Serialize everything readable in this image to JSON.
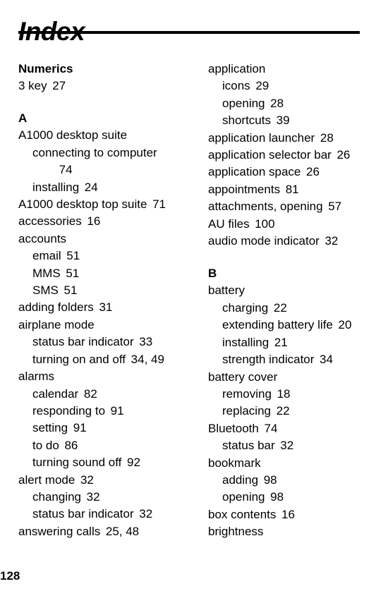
{
  "page": {
    "title": "Index",
    "folio": "128"
  },
  "columns": {
    "left": [
      {
        "kind": "section",
        "label": "Numerics",
        "spaced": false
      },
      {
        "kind": "entry",
        "level": 0,
        "term": "3 key",
        "locator": "27"
      },
      {
        "kind": "section",
        "label": "A",
        "spaced": true
      },
      {
        "kind": "entry",
        "level": 0,
        "term": "A1000 desktop suite",
        "locator": ""
      },
      {
        "kind": "entry",
        "level": 1,
        "term": "connecting to computer",
        "locator": ""
      },
      {
        "kind": "entry",
        "level": 2,
        "term": "",
        "locator": "74"
      },
      {
        "kind": "entry",
        "level": 1,
        "term": "installing",
        "locator": "24"
      },
      {
        "kind": "entry",
        "level": 0,
        "term": "A1000 desktop top suite",
        "locator": "71"
      },
      {
        "kind": "entry",
        "level": 0,
        "term": "accessories",
        "locator": "16"
      },
      {
        "kind": "entry",
        "level": 0,
        "term": "accounts",
        "locator": ""
      },
      {
        "kind": "entry",
        "level": 1,
        "term": "email",
        "locator": "51"
      },
      {
        "kind": "entry",
        "level": 1,
        "term": "MMS",
        "locator": "51"
      },
      {
        "kind": "entry",
        "level": 1,
        "term": "SMS",
        "locator": "51"
      },
      {
        "kind": "entry",
        "level": 0,
        "term": "adding folders",
        "locator": "31"
      },
      {
        "kind": "entry",
        "level": 0,
        "term": "airplane mode",
        "locator": ""
      },
      {
        "kind": "entry",
        "level": 1,
        "term": "status bar indicator",
        "locator": "33"
      },
      {
        "kind": "entry",
        "level": 1,
        "term": "turning on and off",
        "locator": "34, 49"
      },
      {
        "kind": "entry",
        "level": 0,
        "term": "alarms",
        "locator": ""
      },
      {
        "kind": "entry",
        "level": 1,
        "term": "calendar",
        "locator": "82"
      },
      {
        "kind": "entry",
        "level": 1,
        "term": "responding to",
        "locator": "91"
      },
      {
        "kind": "entry",
        "level": 1,
        "term": "setting",
        "locator": "91"
      },
      {
        "kind": "entry",
        "level": 1,
        "term": "to do",
        "locator": "86"
      },
      {
        "kind": "entry",
        "level": 1,
        "term": "turning sound off",
        "locator": "92"
      },
      {
        "kind": "entry",
        "level": 0,
        "term": "alert mode",
        "locator": "32"
      },
      {
        "kind": "entry",
        "level": 1,
        "term": "changing",
        "locator": "32"
      },
      {
        "kind": "entry",
        "level": 1,
        "term": "status bar indicator",
        "locator": "32"
      },
      {
        "kind": "entry",
        "level": 0,
        "term": "answering calls",
        "locator": "25, 48"
      }
    ],
    "right": [
      {
        "kind": "entry",
        "level": 0,
        "term": "application",
        "locator": ""
      },
      {
        "kind": "entry",
        "level": 1,
        "term": "icons",
        "locator": "29"
      },
      {
        "kind": "entry",
        "level": 1,
        "term": "opening",
        "locator": "28"
      },
      {
        "kind": "entry",
        "level": 1,
        "term": "shortcuts",
        "locator": "39"
      },
      {
        "kind": "entry",
        "level": 0,
        "term": "application launcher",
        "locator": "28"
      },
      {
        "kind": "entry",
        "level": 0,
        "term": "application selector bar",
        "locator": "26"
      },
      {
        "kind": "entry",
        "level": 0,
        "term": "application space",
        "locator": "26"
      },
      {
        "kind": "entry",
        "level": 0,
        "term": "appointments",
        "locator": "81"
      },
      {
        "kind": "entry",
        "level": 0,
        "term": "attachments, opening",
        "locator": "57"
      },
      {
        "kind": "entry",
        "level": 0,
        "term": "AU files",
        "locator": "100"
      },
      {
        "kind": "entry",
        "level": 0,
        "term": "audio mode indicator",
        "locator": "32"
      },
      {
        "kind": "section",
        "label": "B",
        "spaced": true
      },
      {
        "kind": "entry",
        "level": 0,
        "term": "battery",
        "locator": ""
      },
      {
        "kind": "entry",
        "level": 1,
        "term": "charging",
        "locator": "22"
      },
      {
        "kind": "entry",
        "level": 1,
        "term": "extending battery life",
        "locator": "20"
      },
      {
        "kind": "entry",
        "level": 1,
        "term": "installing",
        "locator": "21"
      },
      {
        "kind": "entry",
        "level": 1,
        "term": "strength indicator",
        "locator": "34"
      },
      {
        "kind": "entry",
        "level": 0,
        "term": "battery cover",
        "locator": ""
      },
      {
        "kind": "entry",
        "level": 1,
        "term": "removing",
        "locator": "18"
      },
      {
        "kind": "entry",
        "level": 1,
        "term": "replacing",
        "locator": "22"
      },
      {
        "kind": "entry",
        "level": 0,
        "term": "Bluetooth",
        "locator": "74"
      },
      {
        "kind": "entry",
        "level": 1,
        "term": "status bar",
        "locator": "32"
      },
      {
        "kind": "entry",
        "level": 0,
        "term": "bookmark",
        "locator": ""
      },
      {
        "kind": "entry",
        "level": 1,
        "term": "adding",
        "locator": "98"
      },
      {
        "kind": "entry",
        "level": 1,
        "term": "opening",
        "locator": "98"
      },
      {
        "kind": "entry",
        "level": 0,
        "term": "box contents",
        "locator": "16"
      },
      {
        "kind": "entry",
        "level": 0,
        "term": "brightness",
        "locator": ""
      }
    ]
  }
}
